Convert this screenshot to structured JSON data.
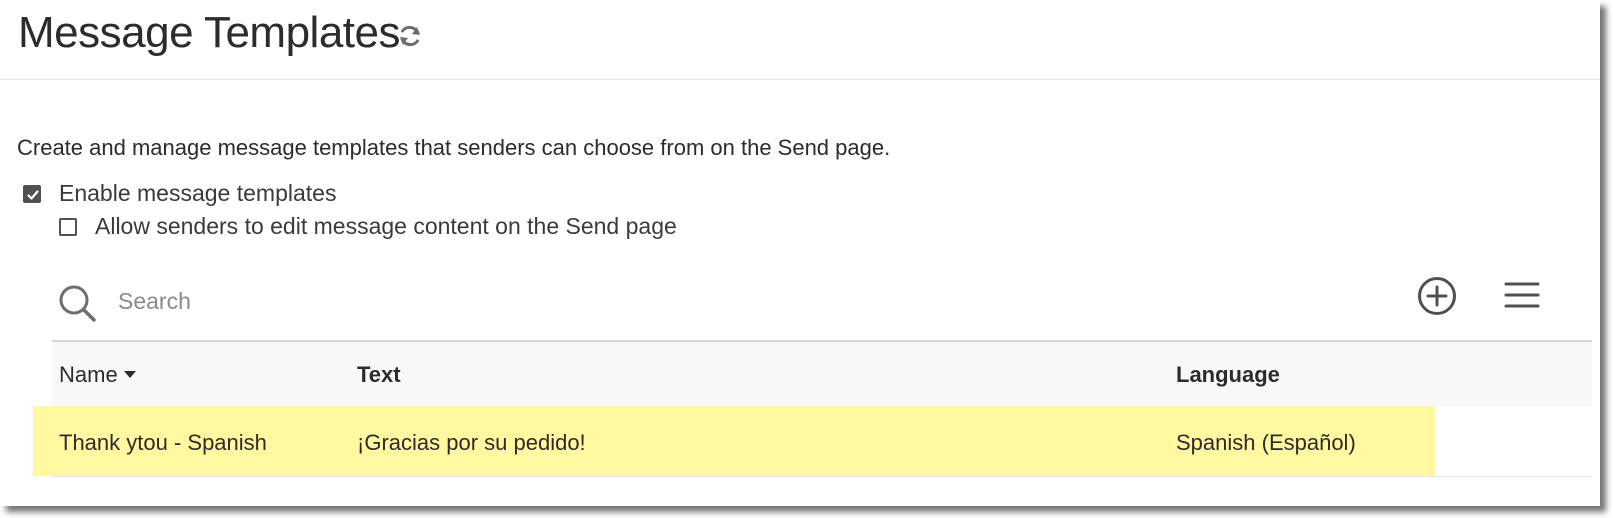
{
  "header": {
    "title": "Message Templates"
  },
  "description": "Create and manage message templates that senders can choose from on the Send page.",
  "options": {
    "enable": {
      "label": "Enable message templates",
      "checked": true
    },
    "allow_edit": {
      "label": "Allow senders to edit message content on the Send page",
      "checked": false
    }
  },
  "search": {
    "placeholder": "Search",
    "value": ""
  },
  "icons": {
    "refresh": "refresh-icon",
    "search": "search-icon",
    "add": "plus-circle-icon",
    "menu": "hamburger-menu-icon",
    "sort": "caret-down-icon"
  },
  "table": {
    "columns": [
      "Name",
      "Text",
      "Language"
    ],
    "sort_column": "Name",
    "rows": [
      {
        "name": "Thank ytou - Spanish",
        "text": "¡Gracias por su pedido!",
        "language": "Spanish (Español)",
        "highlighted": true
      }
    ]
  },
  "colors": {
    "row_highlight": "#fff8a0",
    "text": "#2c2c2c",
    "icon": "#505050"
  }
}
